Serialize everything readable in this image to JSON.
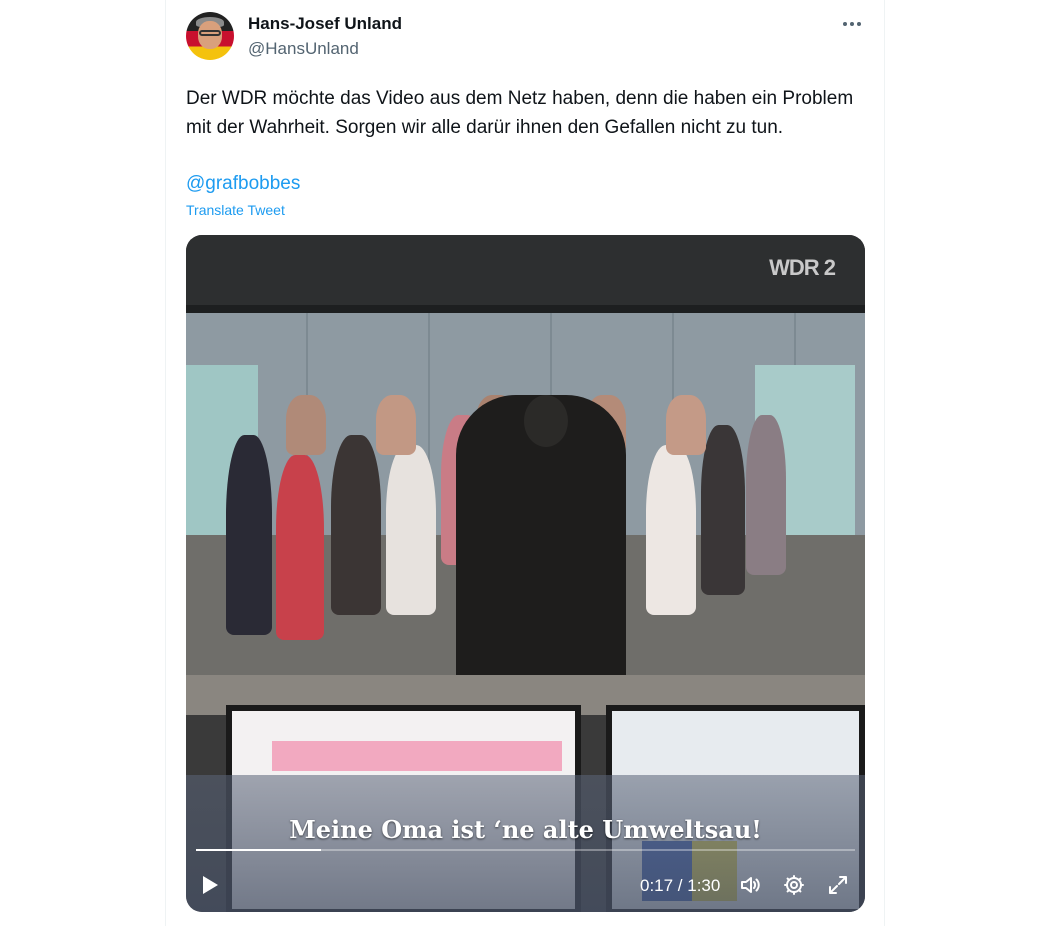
{
  "author": {
    "display_name": "Hans-Josef Unland",
    "handle": "@HansUnland"
  },
  "tweet": {
    "text": "Der WDR möchte das Video aus dem Netz haben, denn die haben ein Problem mit der Wahrheit. Sorgen wir alle darür ihnen den Gefallen nicht zu tun.",
    "mention": "@grafbobbes",
    "translate_label": "Translate Tweet"
  },
  "video": {
    "watermark": "WDR 2",
    "subtitle": "Meine Oma ist ‘ne alte Umweltsau!",
    "time_display": "0:17 / 1:30",
    "progress_fraction": 0.189
  },
  "icons": {
    "more": "more-horizontal-icon",
    "play": "play-icon",
    "volume": "volume-icon",
    "settings": "gear-icon",
    "fullscreen": "fullscreen-icon"
  },
  "colors": {
    "link": "#1d9bf0",
    "secondary_text": "#536471"
  }
}
